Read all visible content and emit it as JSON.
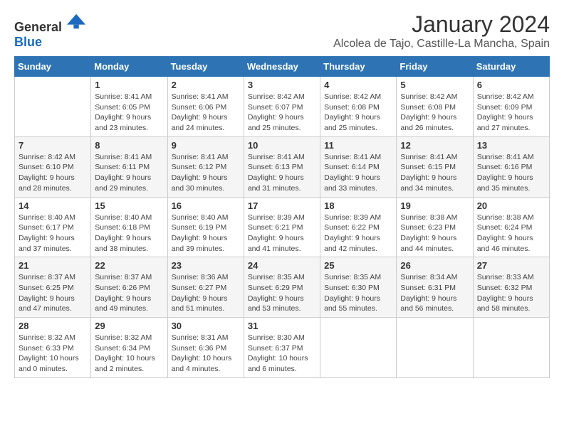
{
  "logo": {
    "text_general": "General",
    "text_blue": "Blue"
  },
  "title": "January 2024",
  "location": "Alcolea de Tajo, Castille-La Mancha, Spain",
  "days_of_week": [
    "Sunday",
    "Monday",
    "Tuesday",
    "Wednesday",
    "Thursday",
    "Friday",
    "Saturday"
  ],
  "weeks": [
    [
      {
        "day": "",
        "sunrise": "",
        "sunset": "",
        "daylight": ""
      },
      {
        "day": "1",
        "sunrise": "Sunrise: 8:41 AM",
        "sunset": "Sunset: 6:05 PM",
        "daylight": "Daylight: 9 hours and 23 minutes."
      },
      {
        "day": "2",
        "sunrise": "Sunrise: 8:41 AM",
        "sunset": "Sunset: 6:06 PM",
        "daylight": "Daylight: 9 hours and 24 minutes."
      },
      {
        "day": "3",
        "sunrise": "Sunrise: 8:42 AM",
        "sunset": "Sunset: 6:07 PM",
        "daylight": "Daylight: 9 hours and 25 minutes."
      },
      {
        "day": "4",
        "sunrise": "Sunrise: 8:42 AM",
        "sunset": "Sunset: 6:08 PM",
        "daylight": "Daylight: 9 hours and 25 minutes."
      },
      {
        "day": "5",
        "sunrise": "Sunrise: 8:42 AM",
        "sunset": "Sunset: 6:08 PM",
        "daylight": "Daylight: 9 hours and 26 minutes."
      },
      {
        "day": "6",
        "sunrise": "Sunrise: 8:42 AM",
        "sunset": "Sunset: 6:09 PM",
        "daylight": "Daylight: 9 hours and 27 minutes."
      }
    ],
    [
      {
        "day": "7",
        "sunrise": "Sunrise: 8:42 AM",
        "sunset": "Sunset: 6:10 PM",
        "daylight": "Daylight: 9 hours and 28 minutes."
      },
      {
        "day": "8",
        "sunrise": "Sunrise: 8:41 AM",
        "sunset": "Sunset: 6:11 PM",
        "daylight": "Daylight: 9 hours and 29 minutes."
      },
      {
        "day": "9",
        "sunrise": "Sunrise: 8:41 AM",
        "sunset": "Sunset: 6:12 PM",
        "daylight": "Daylight: 9 hours and 30 minutes."
      },
      {
        "day": "10",
        "sunrise": "Sunrise: 8:41 AM",
        "sunset": "Sunset: 6:13 PM",
        "daylight": "Daylight: 9 hours and 31 minutes."
      },
      {
        "day": "11",
        "sunrise": "Sunrise: 8:41 AM",
        "sunset": "Sunset: 6:14 PM",
        "daylight": "Daylight: 9 hours and 33 minutes."
      },
      {
        "day": "12",
        "sunrise": "Sunrise: 8:41 AM",
        "sunset": "Sunset: 6:15 PM",
        "daylight": "Daylight: 9 hours and 34 minutes."
      },
      {
        "day": "13",
        "sunrise": "Sunrise: 8:41 AM",
        "sunset": "Sunset: 6:16 PM",
        "daylight": "Daylight: 9 hours and 35 minutes."
      }
    ],
    [
      {
        "day": "14",
        "sunrise": "Sunrise: 8:40 AM",
        "sunset": "Sunset: 6:17 PM",
        "daylight": "Daylight: 9 hours and 37 minutes."
      },
      {
        "day": "15",
        "sunrise": "Sunrise: 8:40 AM",
        "sunset": "Sunset: 6:18 PM",
        "daylight": "Daylight: 9 hours and 38 minutes."
      },
      {
        "day": "16",
        "sunrise": "Sunrise: 8:40 AM",
        "sunset": "Sunset: 6:19 PM",
        "daylight": "Daylight: 9 hours and 39 minutes."
      },
      {
        "day": "17",
        "sunrise": "Sunrise: 8:39 AM",
        "sunset": "Sunset: 6:21 PM",
        "daylight": "Daylight: 9 hours and 41 minutes."
      },
      {
        "day": "18",
        "sunrise": "Sunrise: 8:39 AM",
        "sunset": "Sunset: 6:22 PM",
        "daylight": "Daylight: 9 hours and 42 minutes."
      },
      {
        "day": "19",
        "sunrise": "Sunrise: 8:38 AM",
        "sunset": "Sunset: 6:23 PM",
        "daylight": "Daylight: 9 hours and 44 minutes."
      },
      {
        "day": "20",
        "sunrise": "Sunrise: 8:38 AM",
        "sunset": "Sunset: 6:24 PM",
        "daylight": "Daylight: 9 hours and 46 minutes."
      }
    ],
    [
      {
        "day": "21",
        "sunrise": "Sunrise: 8:37 AM",
        "sunset": "Sunset: 6:25 PM",
        "daylight": "Daylight: 9 hours and 47 minutes."
      },
      {
        "day": "22",
        "sunrise": "Sunrise: 8:37 AM",
        "sunset": "Sunset: 6:26 PM",
        "daylight": "Daylight: 9 hours and 49 minutes."
      },
      {
        "day": "23",
        "sunrise": "Sunrise: 8:36 AM",
        "sunset": "Sunset: 6:27 PM",
        "daylight": "Daylight: 9 hours and 51 minutes."
      },
      {
        "day": "24",
        "sunrise": "Sunrise: 8:35 AM",
        "sunset": "Sunset: 6:29 PM",
        "daylight": "Daylight: 9 hours and 53 minutes."
      },
      {
        "day": "25",
        "sunrise": "Sunrise: 8:35 AM",
        "sunset": "Sunset: 6:30 PM",
        "daylight": "Daylight: 9 hours and 55 minutes."
      },
      {
        "day": "26",
        "sunrise": "Sunrise: 8:34 AM",
        "sunset": "Sunset: 6:31 PM",
        "daylight": "Daylight: 9 hours and 56 minutes."
      },
      {
        "day": "27",
        "sunrise": "Sunrise: 8:33 AM",
        "sunset": "Sunset: 6:32 PM",
        "daylight": "Daylight: 9 hours and 58 minutes."
      }
    ],
    [
      {
        "day": "28",
        "sunrise": "Sunrise: 8:32 AM",
        "sunset": "Sunset: 6:33 PM",
        "daylight": "Daylight: 10 hours and 0 minutes."
      },
      {
        "day": "29",
        "sunrise": "Sunrise: 8:32 AM",
        "sunset": "Sunset: 6:34 PM",
        "daylight": "Daylight: 10 hours and 2 minutes."
      },
      {
        "day": "30",
        "sunrise": "Sunrise: 8:31 AM",
        "sunset": "Sunset: 6:36 PM",
        "daylight": "Daylight: 10 hours and 4 minutes."
      },
      {
        "day": "31",
        "sunrise": "Sunrise: 8:30 AM",
        "sunset": "Sunset: 6:37 PM",
        "daylight": "Daylight: 10 hours and 6 minutes."
      },
      {
        "day": "",
        "sunrise": "",
        "sunset": "",
        "daylight": ""
      },
      {
        "day": "",
        "sunrise": "",
        "sunset": "",
        "daylight": ""
      },
      {
        "day": "",
        "sunrise": "",
        "sunset": "",
        "daylight": ""
      }
    ]
  ]
}
